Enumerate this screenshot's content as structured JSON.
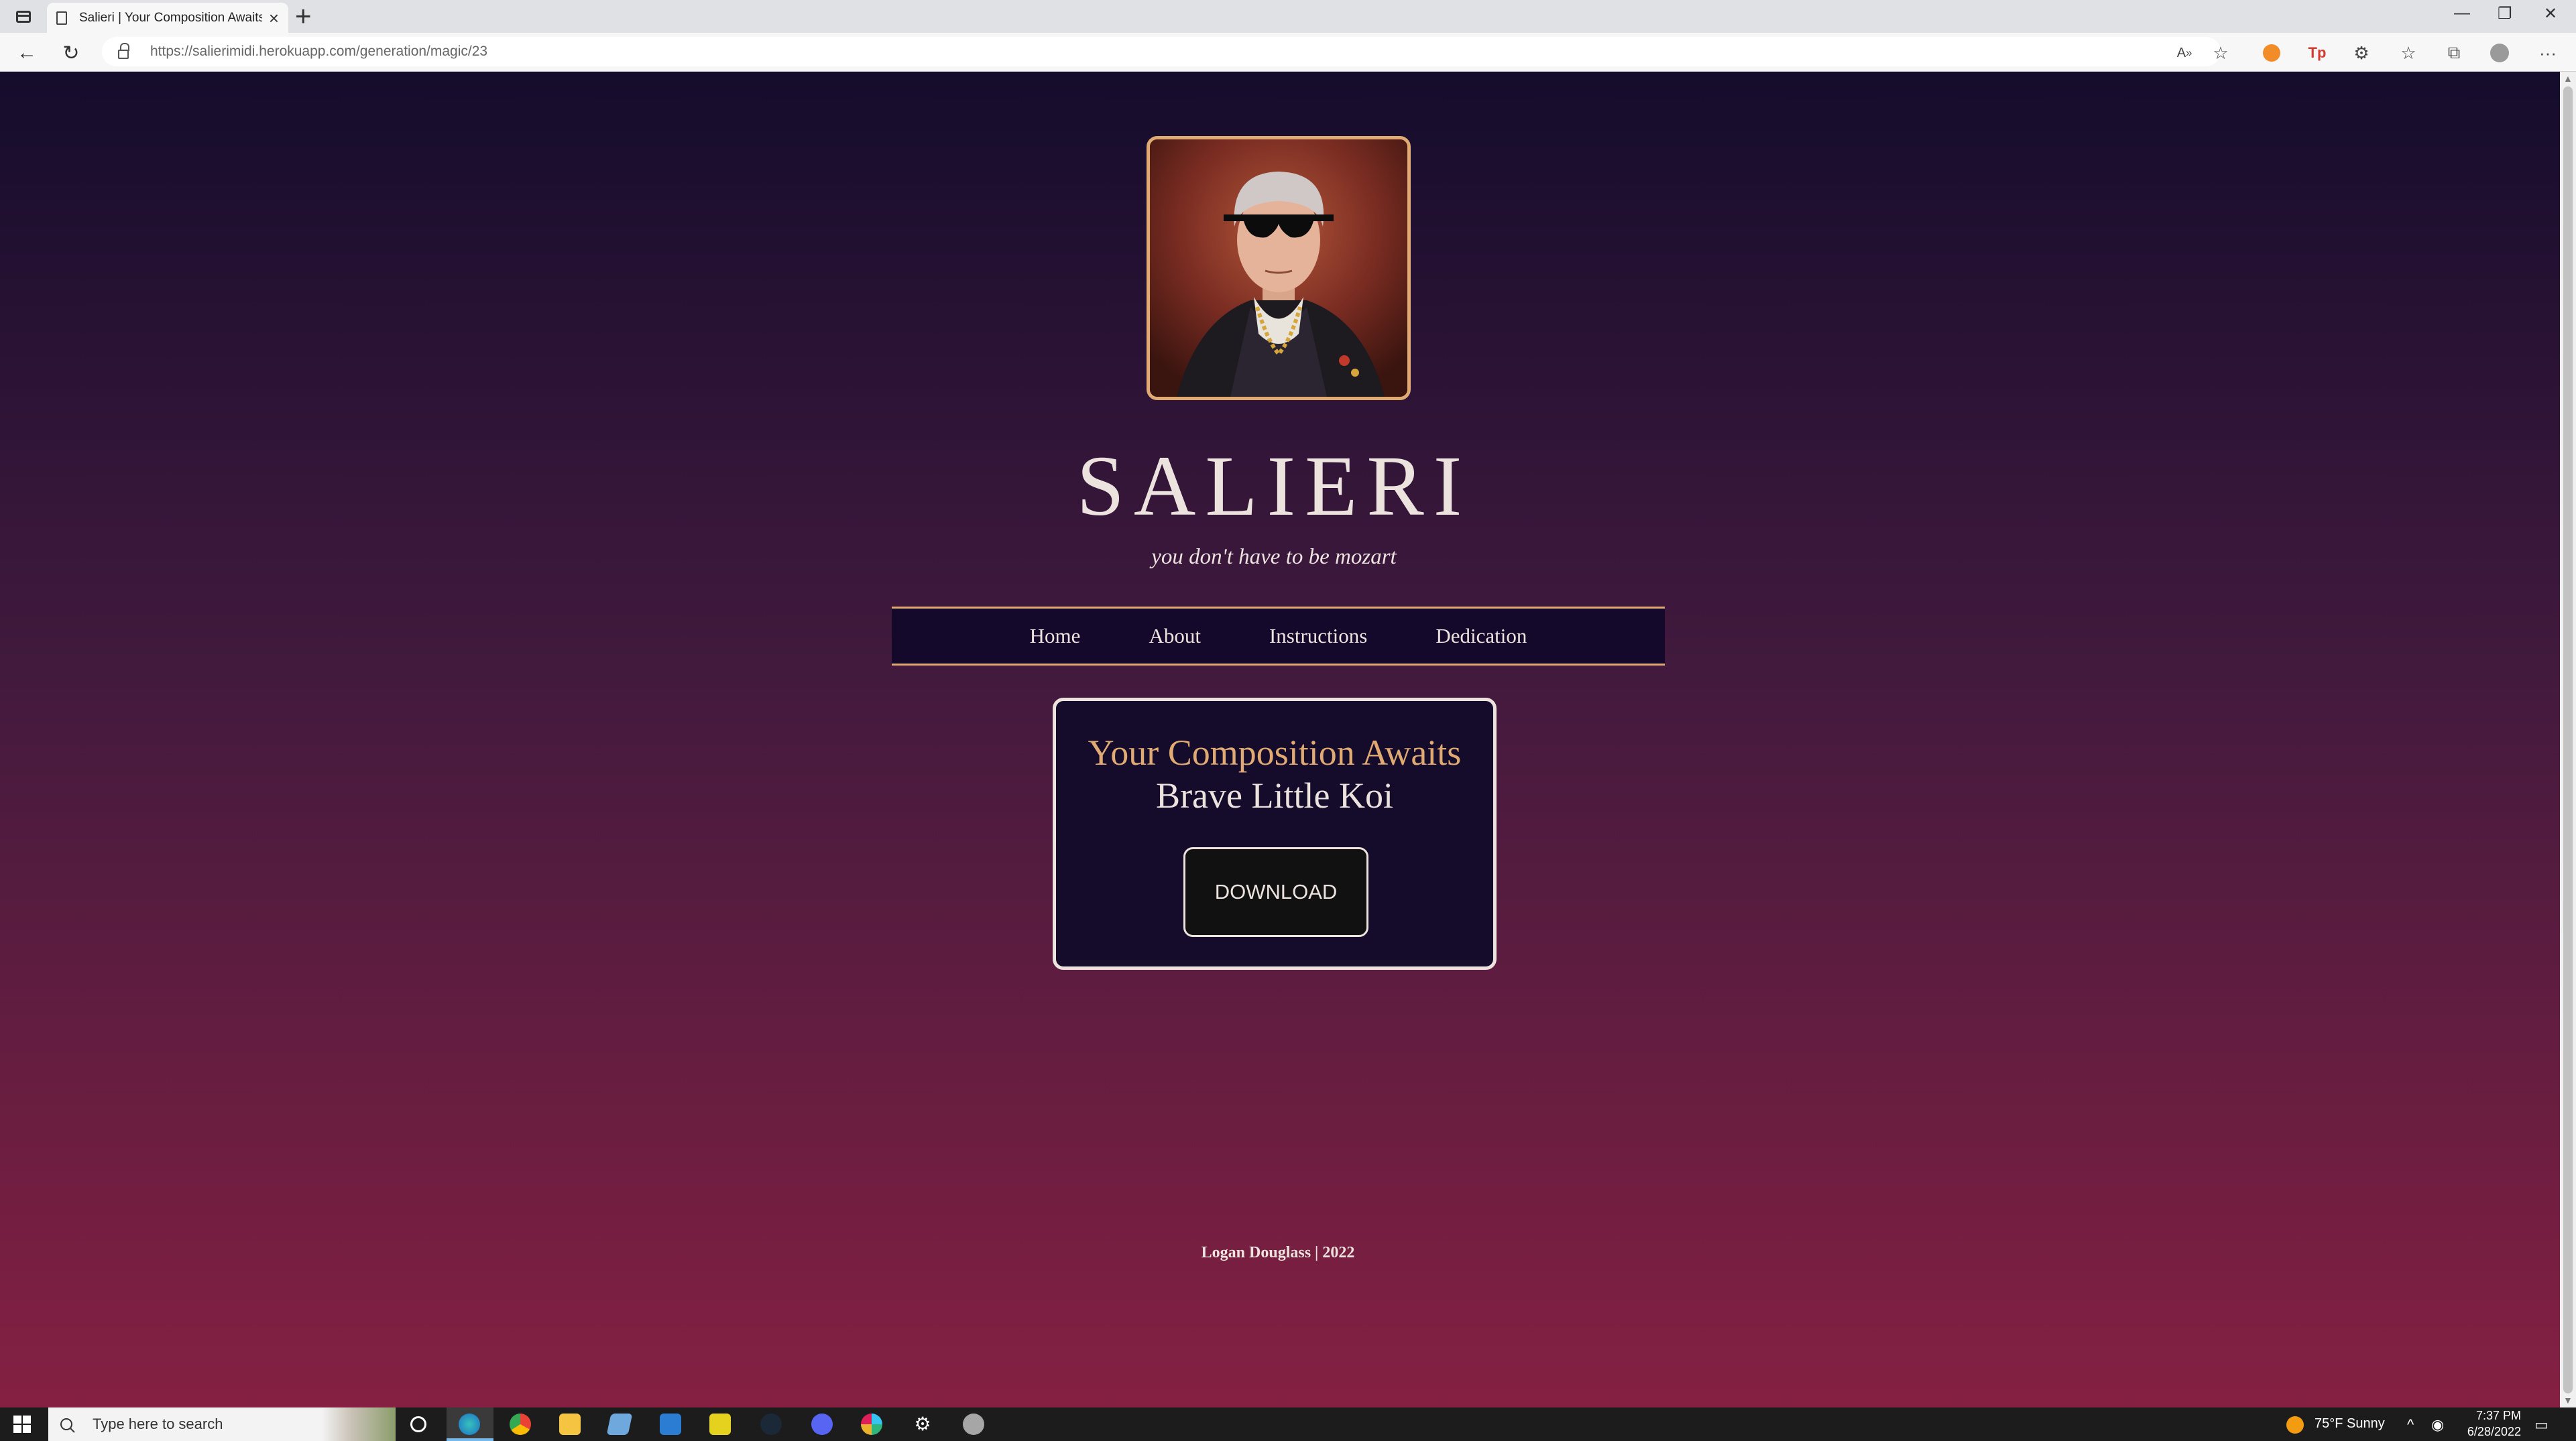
{
  "browser": {
    "tab_title": "Salieri | Your Composition Awaits",
    "url": "https://salierimidi.herokuapp.com/generation/magic/23"
  },
  "site": {
    "title": "SALIERI",
    "tagline": "you don't have to be mozart",
    "nav": [
      "Home",
      "About",
      "Instructions",
      "Dedication"
    ],
    "card_heading": "Your Composition Awaits",
    "composition_name": "Brave Little Koi",
    "download_label": "DOWNLOAD",
    "footer": "Logan Douglass | 2022"
  },
  "taskbar": {
    "search_placeholder": "Type here to search",
    "weather": "75°F  Sunny",
    "time": "7:37 PM",
    "date": "6/28/2022"
  },
  "colors": {
    "accent_gold": "#e0aa72",
    "text_cream": "#ece3df",
    "nav_bg": "#14092a",
    "gradient_top": "#150c2c",
    "gradient_bottom": "#852042"
  }
}
